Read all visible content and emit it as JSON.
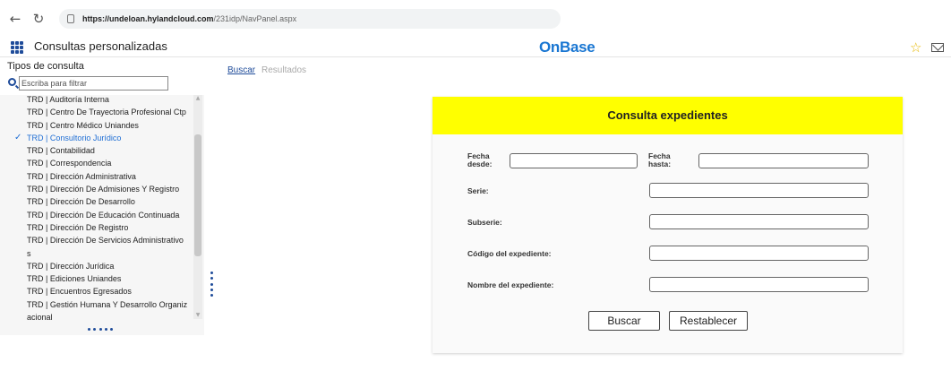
{
  "browser": {
    "url_host": "https://undeloan.hylandcloud.com",
    "url_path": "/231idp/NavPanel.aspx",
    "back_icon": "arrow-left-icon",
    "reload_icon": "reload-icon"
  },
  "header": {
    "title": "Consultas personalizadas",
    "brand": "OnBase",
    "brand_color": "#1976d2",
    "star_icon": "star-icon",
    "mail_icon": "mail-icon"
  },
  "sidebar": {
    "title": "Tipos de consulta",
    "filter_placeholder": "Escriba para filtrar",
    "items": [
      {
        "label": "TRD | Auditoría Interna",
        "selected": false
      },
      {
        "label": "TRD | Centro De Trayectoria Profesional Ctp",
        "selected": false
      },
      {
        "label": "TRD | Centro Médico Uniandes",
        "selected": false
      },
      {
        "label": "TRD | Consultorio Jurídico",
        "selected": true
      },
      {
        "label": "TRD | Contabilidad",
        "selected": false
      },
      {
        "label": "TRD | Correspondencia",
        "selected": false
      },
      {
        "label": "TRD | Dirección Administrativa",
        "selected": false
      },
      {
        "label": "TRD | Dirección De Admisiones Y Registro",
        "selected": false
      },
      {
        "label": "TRD | Dirección De Desarrollo",
        "selected": false
      },
      {
        "label": "TRD | Dirección De Educación Continuada",
        "selected": false
      },
      {
        "label": "TRD | Dirección De Registro",
        "selected": false
      },
      {
        "label": "TRD | Dirección De Servicios Administrativo s",
        "selected": false
      },
      {
        "label": "TRD | Dirección Jurídica",
        "selected": false
      },
      {
        "label": "TRD | Ediciones Uniandes",
        "selected": false
      },
      {
        "label": "TRD | Encuentros Egresados",
        "selected": false
      },
      {
        "label": "TRD | Gestión Humana Y Desarrollo Organiz acional",
        "selected": false
      }
    ]
  },
  "tabs": [
    {
      "label": "Buscar",
      "active": true
    },
    {
      "label": "Resultados",
      "active": false
    }
  ],
  "form": {
    "title": "Consulta expedientes",
    "header_color": "#ffff00",
    "fecha_desde_label": "Fecha desde:",
    "fecha_hasta_label": "Fecha hasta:",
    "serie_label": "Serie:",
    "subserie_label": "Subserie:",
    "codigo_label": "Código del expediente:",
    "nombre_label": "Nombre del expediente:",
    "buscar_button": "Buscar",
    "restablecer_button": "Restablecer"
  }
}
